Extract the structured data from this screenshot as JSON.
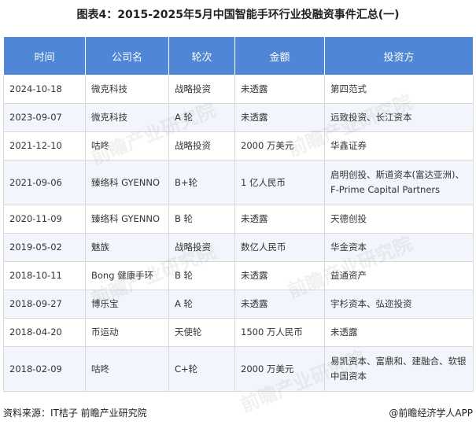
{
  "title": "图表4：2015-2025年5月中国智能手环行业投融资事件汇总(一)",
  "table": {
    "headers": [
      "时间",
      "公司名",
      "轮次",
      "金额",
      "投资方"
    ],
    "rows": [
      [
        "2024-10-18",
        "微克科技",
        "战略投资",
        "未透露",
        "第四范式"
      ],
      [
        "2023-09-07",
        "微克科技",
        "A 轮",
        "未透露",
        "远致投资、长江资本"
      ],
      [
        "2021-12-10",
        "咕咚",
        "战略投资",
        "2000 万美元",
        "华鑫证券"
      ],
      [
        "2021-09-06",
        "臻络科 GYENNO",
        "B+轮",
        "1 亿人民币",
        "启明创投、斯道资本(富达亚洲)、F-Prime Capital Partners"
      ],
      [
        "2020-11-09",
        "臻络科 GYENNO",
        "B 轮",
        "未透露",
        "天德创投"
      ],
      [
        "2019-05-02",
        "魅族",
        "战略投资",
        "数亿人民币",
        "华金资本"
      ],
      [
        "2018-10-11",
        "Bong 健康手环",
        "B 轮",
        "未透露",
        "益通资产"
      ],
      [
        "2018-09-27",
        "博乐宝",
        "A 轮",
        "未透露",
        "宇杉资本、弘迩投资"
      ],
      [
        "2018-04-20",
        "币运动",
        "天使轮",
        "1500 万人民币",
        "未透露"
      ],
      [
        "2018-02-09",
        "咕咚",
        "C+轮",
        "2000 万美元",
        "易凯资本、富鼎和、建融合、软银中国资本"
      ]
    ]
  },
  "footer": {
    "source": "资料来源：IT桔子 前瞻产业研究院",
    "brand": "@前瞻经济学人APP"
  },
  "watermark": "前瞻产业研究院"
}
